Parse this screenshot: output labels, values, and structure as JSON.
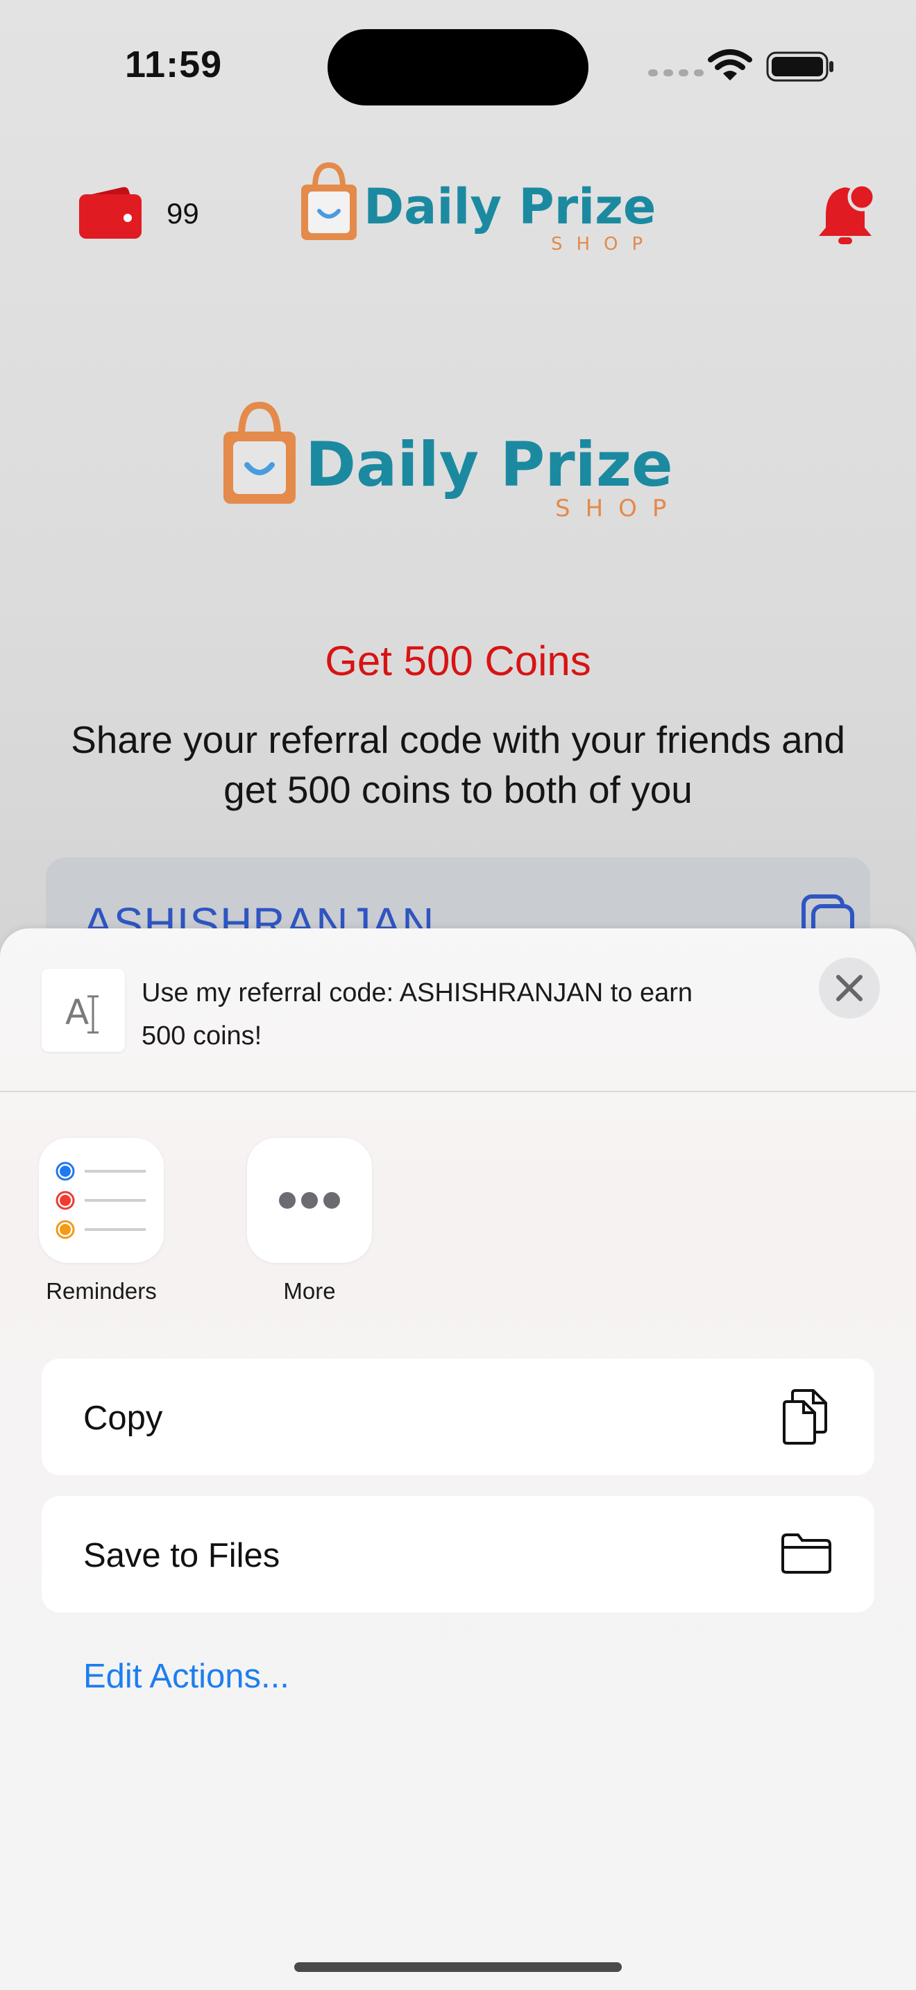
{
  "status_bar": {
    "time": "11:59",
    "signal_icon": "signal-dots-icon",
    "wifi_icon": "wifi-icon",
    "battery_icon": "battery-icon"
  },
  "header": {
    "wallet_icon": "wallet-icon",
    "coin_count": "99",
    "logo": {
      "title": "Daily Prize",
      "subtitle": "SHOP"
    },
    "bell_icon": "bell-notification-icon"
  },
  "main": {
    "logo": {
      "title": "Daily Prize",
      "subtitle": "SHOP"
    },
    "promo_title": "Get 500 Coins",
    "promo_description": "Share your referral code with your friends and get 500 coins to both of you",
    "referral_code": "ASHISHRANJAN"
  },
  "share_sheet": {
    "preview_text": "Use my referral code: ASHISHRANJAN to earn 500 coins!",
    "apps": [
      {
        "label": "Reminders",
        "icon": "reminders-app-icon"
      },
      {
        "label": "More",
        "icon": "more-dots-icon"
      }
    ],
    "actions": [
      {
        "label": "Copy",
        "icon": "copy-documents-icon"
      },
      {
        "label": "Save to Files",
        "icon": "folder-icon"
      }
    ],
    "edit_actions": "Edit Actions..."
  },
  "colors": {
    "accent_red": "#d81313",
    "logo_teal": "#1b8aa0",
    "logo_orange": "#e48a4a",
    "link_blue": "#1d7ef0",
    "code_blue": "#2f55c2"
  }
}
